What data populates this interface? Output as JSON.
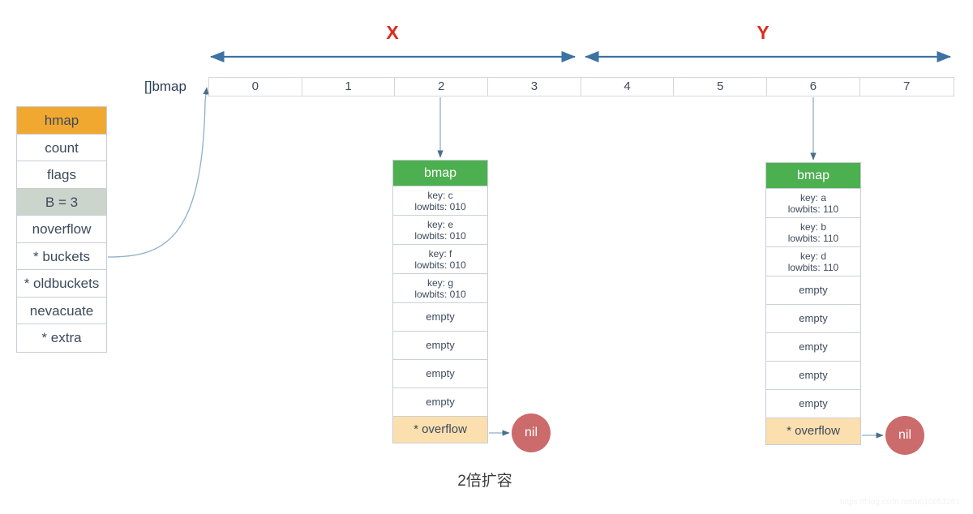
{
  "diagram": {
    "caption": "2倍扩容",
    "watermark": "https://blog.csdn.net/u010853261",
    "bmap_array_label": "[]bmap",
    "colors": {
      "hmap_header": "#f0a830",
      "hmap_highlight": "#cbd5cc",
      "bmap_header": "#4caf50",
      "overflow_row": "#fbdfae",
      "nil_circle": "#cb6b6b",
      "span_label": "#dd2b1c",
      "arrow": "#3d72a4",
      "connector": "#8faec8",
      "text": "#3d4a5c"
    }
  },
  "hmap": {
    "title": "hmap",
    "fields": [
      {
        "label": "hmap",
        "style": "header"
      },
      {
        "label": "count",
        "style": "plain"
      },
      {
        "label": "flags",
        "style": "plain"
      },
      {
        "label": "B = 3",
        "style": "highlight"
      },
      {
        "label": "noverflow",
        "style": "plain"
      },
      {
        "label": "* buckets",
        "style": "plain"
      },
      {
        "label": "* oldbuckets",
        "style": "plain"
      },
      {
        "label": "nevacuate",
        "style": "plain"
      },
      {
        "label": "* extra",
        "style": "plain"
      }
    ]
  },
  "bucket_array": {
    "cells": [
      "0",
      "1",
      "2",
      "3",
      "4",
      "5",
      "6",
      "7"
    ]
  },
  "spans": [
    {
      "label": "X",
      "from_cell": 0,
      "to_cell": 3
    },
    {
      "label": "Y",
      "from_cell": 4,
      "to_cell": 7
    }
  ],
  "buckets": [
    {
      "id": "bmap-left",
      "header": "bmap",
      "source_cell": "2",
      "slots": [
        {
          "type": "kv",
          "key": "key: c",
          "lowbits": "lowbits: 010"
        },
        {
          "type": "kv",
          "key": "key: e",
          "lowbits": "lowbits: 010"
        },
        {
          "type": "kv",
          "key": "key: f",
          "lowbits": "lowbits: 010"
        },
        {
          "type": "kv",
          "key": "key: g",
          "lowbits": "lowbits: 010"
        },
        {
          "type": "empty",
          "label": "empty"
        },
        {
          "type": "empty",
          "label": "empty"
        },
        {
          "type": "empty",
          "label": "empty"
        },
        {
          "type": "empty",
          "label": "empty"
        }
      ],
      "overflow": {
        "label": "* overflow",
        "target": "nil"
      }
    },
    {
      "id": "bmap-right",
      "header": "bmap",
      "source_cell": "6",
      "slots": [
        {
          "type": "kv",
          "key": "key: a",
          "lowbits": "lowbits: 110"
        },
        {
          "type": "kv",
          "key": "key: b",
          "lowbits": "lowbits: 110"
        },
        {
          "type": "kv",
          "key": "key: d",
          "lowbits": "lowbits: 110"
        },
        {
          "type": "empty",
          "label": "empty"
        },
        {
          "type": "empty",
          "label": "empty"
        },
        {
          "type": "empty",
          "label": "empty"
        },
        {
          "type": "empty",
          "label": "empty"
        },
        {
          "type": "empty",
          "label": "empty"
        }
      ],
      "overflow": {
        "label": "* overflow",
        "target": "nil"
      }
    }
  ],
  "nil_nodes": [
    {
      "label": "nil"
    },
    {
      "label": "nil"
    }
  ]
}
